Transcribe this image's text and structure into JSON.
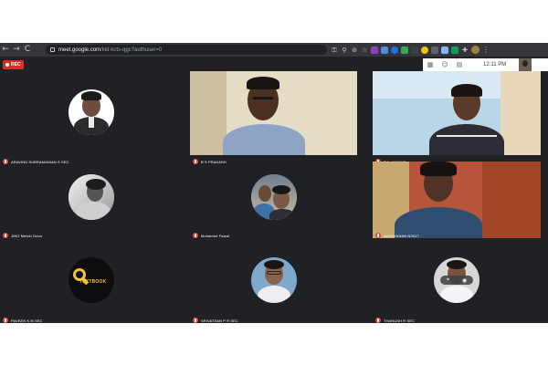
{
  "browser": {
    "nav": {
      "back": "←",
      "forward": "→",
      "reload": "C"
    },
    "url_host": "meet.google.com",
    "url_path": "/kid-kcts-qgc?authuser=0",
    "extension_icons": [
      "key-icon",
      "search-icon",
      "blocked-icon",
      "star-icon",
      "ext-purple",
      "ext-folder",
      "ext-blue",
      "ext-green",
      "ext-dark",
      "ext-yellow",
      "ext-cast",
      "ext-calendar",
      "ext-meet",
      "puzzle-icon"
    ]
  },
  "meet": {
    "rec_label": "REC",
    "time": "12:11 PM",
    "accent_red": "#ea4335",
    "background": "#202124"
  },
  "participants": [
    {
      "name": "ARAVIND SUBRAMANIAN S SEC",
      "muted": true
    },
    {
      "name": "B S  PRAKASH",
      "muted": true
    },
    {
      "name": "RA...KUMAR",
      "muted": true
    },
    {
      "name": "JINO Melvin Dova",
      "muted": true
    },
    {
      "name": "Mohamed Faizal",
      "muted": true
    },
    {
      "name": "NARAYANAN N2017",
      "muted": true
    },
    {
      "name": "PAVEEN K M SEC",
      "muted": true
    },
    {
      "name": "SRIVATSAN P R SEC",
      "muted": true
    },
    {
      "name": "THANUSH R SEC",
      "muted": true
    }
  ],
  "logo_text": "TEXTBOOK"
}
